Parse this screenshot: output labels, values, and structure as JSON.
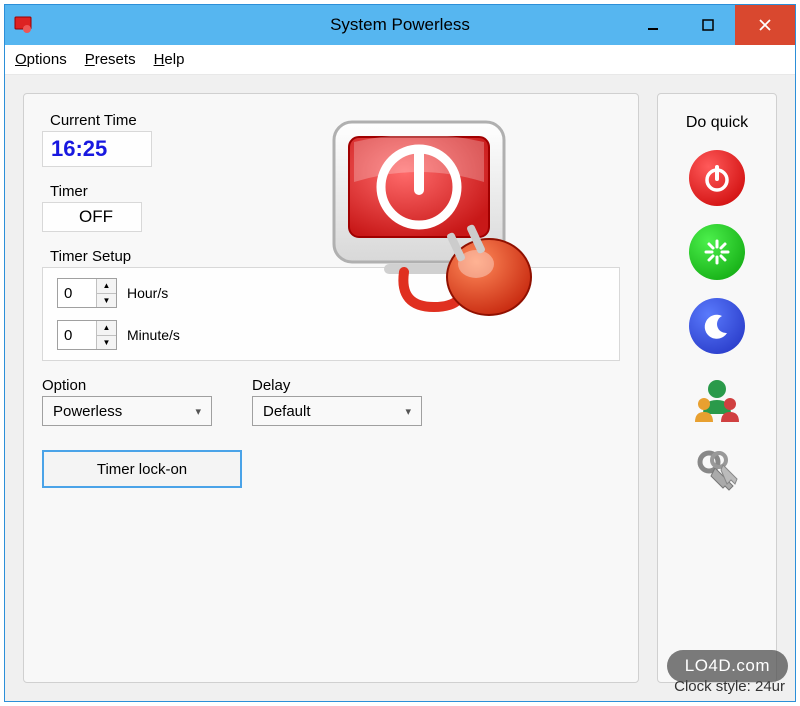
{
  "window": {
    "title": "System Powerless"
  },
  "menu": {
    "options": "Options",
    "presets": "Presets",
    "help": "Help"
  },
  "current_time": {
    "label": "Current Time",
    "value": "16:25"
  },
  "timer": {
    "label": "Timer",
    "value": "OFF"
  },
  "timer_setup": {
    "label": "Timer Setup",
    "hours": "0",
    "hours_label": "Hour/s",
    "minutes": "0",
    "minutes_label": "Minute/s"
  },
  "option": {
    "label": "Option",
    "value": "Powerless"
  },
  "delay": {
    "label": "Delay",
    "value": "Default"
  },
  "timer_lock_button": "Timer lock-on",
  "sidebar": {
    "title": "Do quick"
  },
  "clock_style": "Clock style: 24ur",
  "watermark": "LO4D.com"
}
